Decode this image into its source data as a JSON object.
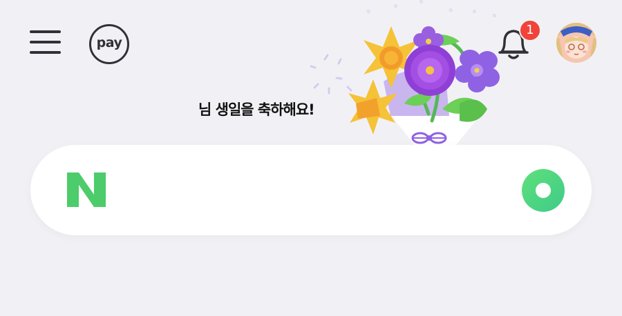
{
  "header": {
    "pay_label": "pay",
    "notification_count": "1",
    "greeting": "님 생일을 축하해요!"
  },
  "icons": {
    "menu": "hamburger-menu-icon",
    "pay": "naver-pay-icon",
    "notification": "bell-icon",
    "avatar": "anime-character-avatar",
    "search_logo": "naver-n-logo",
    "search_action": "green-ring-icon",
    "decoration": "flower-bouquet-illustration"
  },
  "search": {
    "placeholder": ""
  },
  "colors": {
    "background": "#f1f1f5",
    "naver_green": "#4ccc6a",
    "badge_red": "#f0433a",
    "icon_dark": "#303036"
  }
}
